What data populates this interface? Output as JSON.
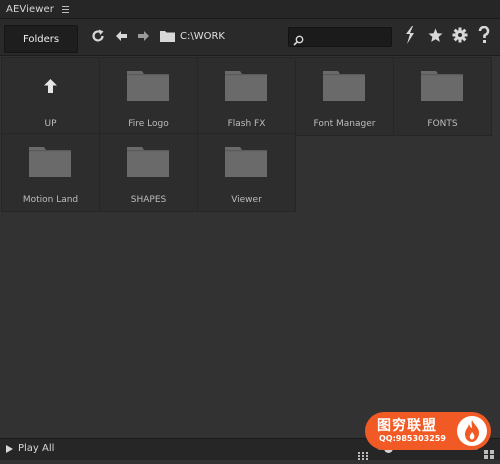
{
  "window": {
    "title": "AEViewer",
    "menu_icon": "hamburger-menu-icon"
  },
  "toolbar": {
    "tab_label": "Folders",
    "path": "C:\\WORK",
    "search_placeholder": "",
    "icons": [
      "refresh-icon",
      "back-arrow-icon",
      "forward-arrow-icon",
      "folder-icon",
      "search-icon",
      "bolt-icon",
      "star-icon",
      "gear-icon",
      "help-icon"
    ]
  },
  "grid": {
    "items": [
      {
        "label": "UP",
        "icon": "up-arrow-icon"
      },
      {
        "label": "Fire Logo",
        "icon": "folder-icon"
      },
      {
        "label": "Flash FX",
        "icon": "folder-icon"
      },
      {
        "label": "Font Manager",
        "icon": "folder-icon"
      },
      {
        "label": "FONTS",
        "icon": "folder-icon"
      },
      {
        "label": "Motion Land",
        "icon": "folder-icon"
      },
      {
        "label": "SHAPES",
        "icon": "folder-icon"
      },
      {
        "label": "Viewer",
        "icon": "folder-icon"
      }
    ]
  },
  "statusbar": {
    "play_all_label": "Play All",
    "thumbnail_size_fraction": 0.1
  },
  "watermark": {
    "title": "图穷联盟",
    "subtitle": "QQ:985303259"
  },
  "colors": {
    "background": "#323232",
    "cell": "#2d2d2d",
    "folder": "#6a6a6a",
    "watermark": "#f15a24"
  }
}
